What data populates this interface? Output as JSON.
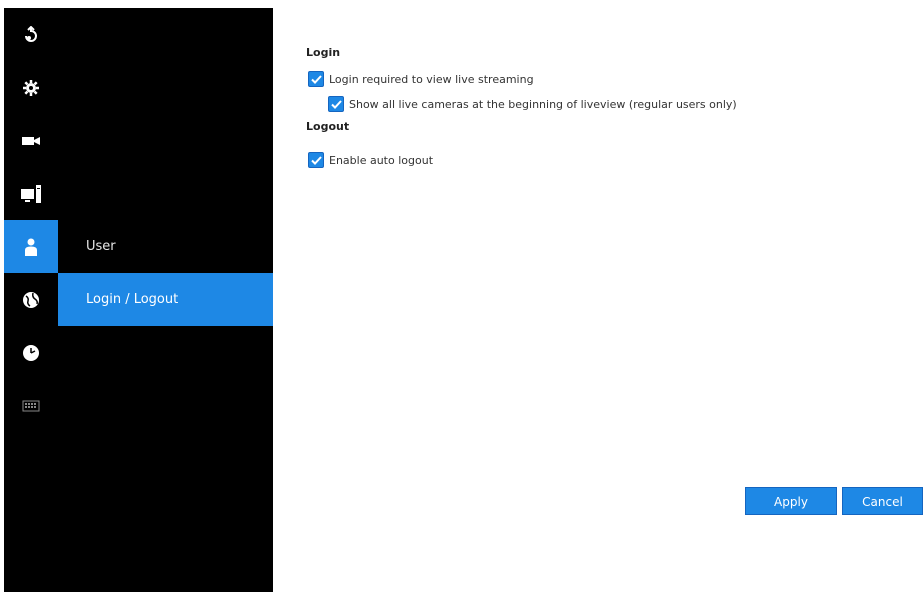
{
  "icon_rail": {
    "items": [
      {
        "icon": "back-icon",
        "active": false
      },
      {
        "icon": "gear-icon",
        "active": false
      },
      {
        "icon": "camera-icon",
        "active": false
      },
      {
        "icon": "computer-icon",
        "active": false
      },
      {
        "icon": "user-icon",
        "active": true
      },
      {
        "icon": "network-icon",
        "active": false
      },
      {
        "icon": "clock-icon",
        "active": false
      },
      {
        "icon": "keyboard-icon",
        "active": false
      }
    ]
  },
  "submenu": {
    "items": [
      {
        "label": "User",
        "active": false
      },
      {
        "label": "Login / Logout",
        "active": true
      }
    ]
  },
  "login": {
    "title": "Login",
    "require_login_label": "Login required to view live streaming",
    "require_login_checked": true,
    "show_all_cameras_label": "Show all live cameras at the beginning of liveview (regular users only)",
    "show_all_cameras_checked": true
  },
  "logout": {
    "title": "Logout",
    "auto_logout_label": "Enable auto logout",
    "auto_logout_checked": true
  },
  "actions": {
    "apply_label": "Apply",
    "cancel_label": "Cancel"
  },
  "colors": {
    "accent": "#1e88e5",
    "sidebar": "#000000",
    "background": "#ffffff"
  }
}
